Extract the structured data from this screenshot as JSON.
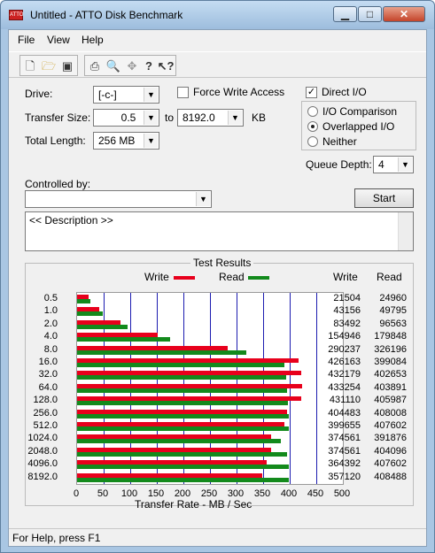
{
  "window": {
    "title": "Untitled - ATTO Disk Benchmark",
    "app_icon_text": "ATTO"
  },
  "menu": [
    "File",
    "View",
    "Help"
  ],
  "toolbar_icons": [
    "new-file-icon",
    "open-folder-icon",
    "save-disk-icon",
    "print-icon",
    "print-preview-icon",
    "move-icon",
    "help-icon",
    "context-help-icon"
  ],
  "form": {
    "drive_label": "Drive:",
    "drive_value": "[-c-]",
    "force_write_label": "Force Write Access",
    "force_write_checked": false,
    "direct_io_label": "Direct I/O",
    "direct_io_checked": true,
    "transfer_size_label": "Transfer Size:",
    "transfer_from": "0.5",
    "to_label": "to",
    "transfer_to": "8192.0",
    "kb_label": "KB",
    "total_length_label": "Total Length:",
    "total_length_value": "256 MB",
    "io_comparison_label": "I/O Comparison",
    "overlapped_io_label": "Overlapped I/O",
    "neither_label": "Neither",
    "selected_mode": "Overlapped I/O",
    "queue_depth_label": "Queue Depth:",
    "queue_depth_value": "4",
    "controlled_by_label": "Controlled by:",
    "controlled_by_value": "",
    "start_label": "Start",
    "description": "<< Description >>"
  },
  "results": {
    "title": "Test Results",
    "write_col": "Write",
    "read_col": "Read",
    "write_color": "#e8001c",
    "read_color": "#138a1c"
  },
  "chart_data": {
    "type": "bar",
    "xlabel": "Transfer Rate - MB / Sec",
    "xlim": [
      0,
      500
    ],
    "xticks": [
      "0",
      "50",
      "100",
      "150",
      "200",
      "250",
      "300",
      "350",
      "400",
      "450",
      "500"
    ],
    "legend": [
      "Write",
      "Read"
    ],
    "categories": [
      "0.5",
      "1.0",
      "2.0",
      "4.0",
      "8.0",
      "16.0",
      "32.0",
      "64.0",
      "128.0",
      "256.0",
      "512.0",
      "1024.0",
      "2048.0",
      "4096.0",
      "8192.0"
    ],
    "series": [
      {
        "name": "Write",
        "values": [
          21504,
          43156,
          83492,
          154946,
          290237,
          426163,
          432179,
          433254,
          431110,
          404483,
          399655,
          374561,
          374561,
          364392,
          357120
        ]
      },
      {
        "name": "Read",
        "values": [
          24960,
          49795,
          96563,
          179848,
          326196,
          399084,
          402653,
          403891,
          405987,
          408008,
          407602,
          391876,
          404096,
          407602,
          408488
        ]
      }
    ],
    "units": "KB/s (bar length in MB/s)"
  },
  "status": "For Help, press F1"
}
